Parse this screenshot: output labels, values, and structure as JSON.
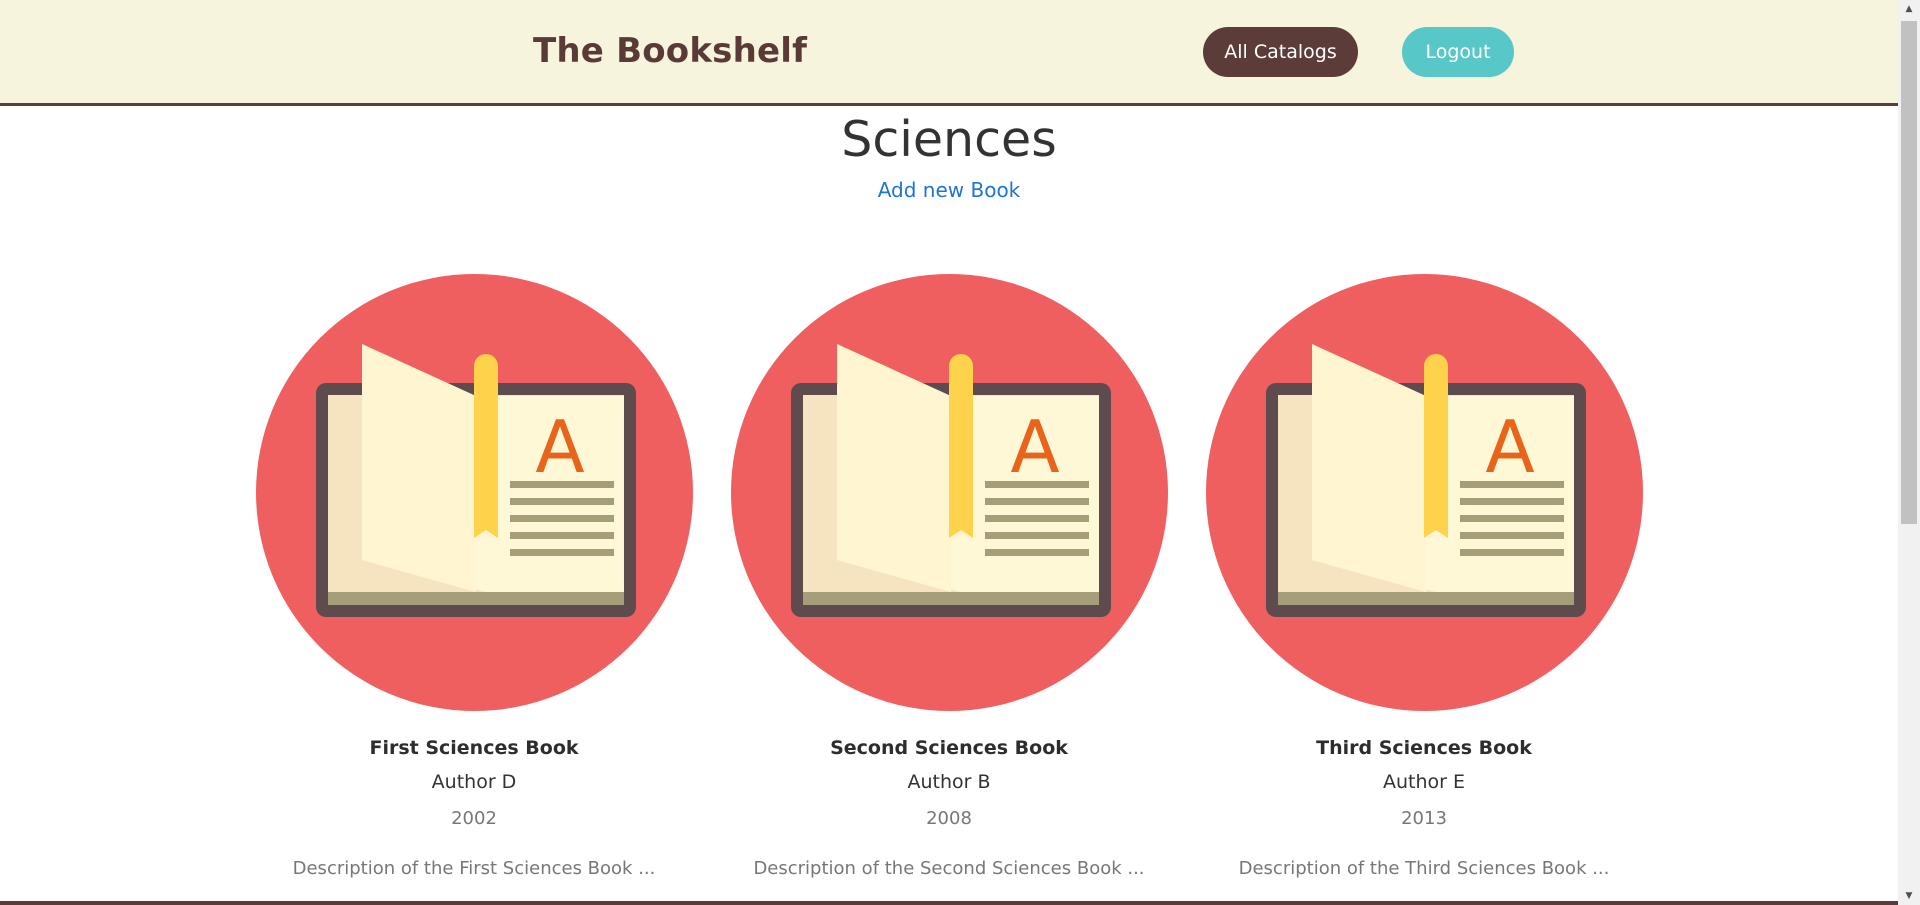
{
  "header": {
    "brand": "The Bookshelf",
    "all_catalogs_label": "All Catalogs",
    "logout_label": "Logout"
  },
  "main": {
    "title": "Sciences",
    "add_book_label": "Add new Book"
  },
  "books": [
    {
      "title": "First Sciences Book",
      "author": "Author D",
      "year": "2002",
      "description": "Description of the First Sciences Book ..."
    },
    {
      "title": "Second Sciences Book",
      "author": "Author B",
      "year": "2008",
      "description": "Description of the Second Sciences Book ..."
    },
    {
      "title": "Third Sciences Book",
      "author": "Author E",
      "year": "2013",
      "description": "Description of the Third Sciences Book ..."
    }
  ],
  "colors": {
    "header_bg": "#f6f4dc",
    "brand": "#5a3a36",
    "catalogs_button": "#5b3c38",
    "logout_button": "#57c7c8",
    "link": "#1f74d6",
    "cover_circle": "#ef5f5f"
  },
  "cover_icon": "open-book-icon"
}
